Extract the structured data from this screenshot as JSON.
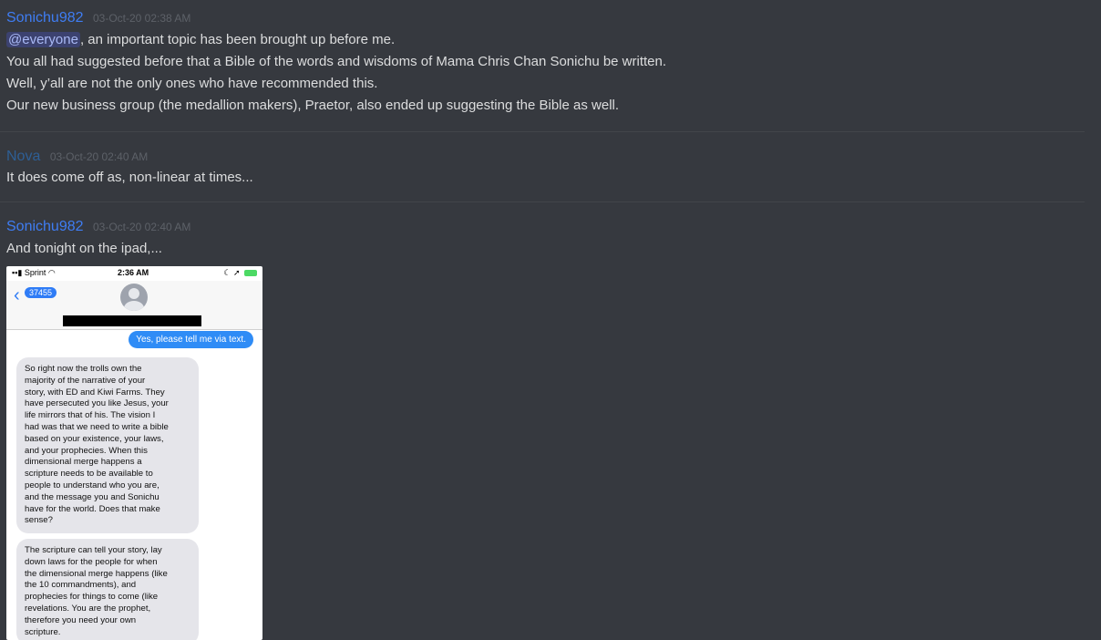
{
  "messages": [
    {
      "author": "Sonichu982",
      "timestamp": "03-Oct-20 02:38 AM",
      "mention": "@everyone",
      "lines": [
        ", an important topic has been brought up before me.",
        "You all had suggested before that a Bible of the words and wisdoms of Mama Chris Chan Sonichu be written.",
        "Well, y’all are not the only ones who have recommended this.",
        "Our new business group (the medallion makers), Praetor, also ended up suggesting the Bible as well."
      ]
    },
    {
      "author": "Nova",
      "timestamp": "03-Oct-20 02:40 AM",
      "lines": [
        "It does come off as, non-linear at times..."
      ]
    },
    {
      "author": "Sonichu982",
      "timestamp": "03-Oct-20 02:40 AM",
      "lines": [
        "And tonight on the ipad,..."
      ]
    }
  ],
  "attachment": {
    "carrier": "Sprint",
    "time": "2:36 AM",
    "back_badge": "37455",
    "outgoing": "Yes, please tell me via text.",
    "incoming": [
      "So right now the trolls own the\nmajority of the narrative of your\nstory, with ED and Kiwi Farms. They\nhave persecuted you like Jesus, your\nlife mirrors that of his. The vision I\nhad was that we need to write a bible\nbased on your existence, your laws,\nand your prophecies. When this\ndimensional merge happens a\nscripture needs to be available to\npeople to understand who you are,\nand the message you and Sonichu\nhave for the world. Does that make\nsense?",
      "The scripture can tell your story, lay\ndown laws for the people for when\nthe dimensional merge happens (like\nthe 10 commandments), and\nprophecies for things to come (like\nrevelations. You are the prophet,\ntherefore you need your own\nscripture."
    ]
  },
  "colors": {
    "background": "#36393f",
    "username_blue": "#3f7df3",
    "username_nova": "#2e5f95",
    "imessage_blue": "#2f8cf6"
  }
}
